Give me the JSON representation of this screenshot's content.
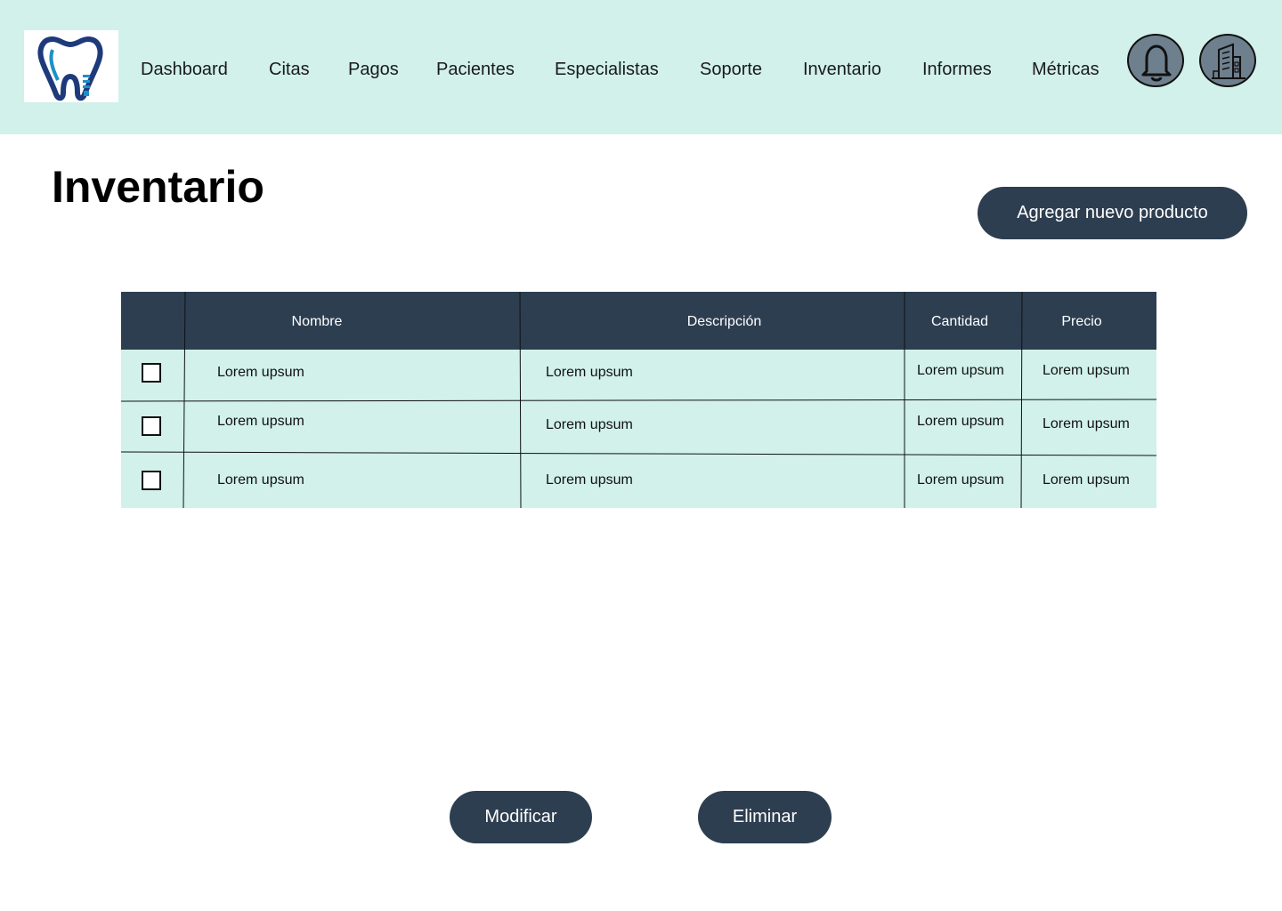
{
  "nav": {
    "items": [
      "Dashboard",
      "Citas",
      "Pagos",
      "Pacientes",
      "Especialistas",
      "Soporte",
      "Inventario",
      "Informes",
      "Métricas"
    ]
  },
  "icons": {
    "logo": "tooth-logo-icon",
    "notifications": "bell-icon",
    "clinic": "building-icon"
  },
  "page": {
    "title": "Inventario",
    "add_button": "Agregar nuevo producto"
  },
  "table": {
    "columns": [
      "Nombre",
      "Descripción",
      "Cantidad",
      "Precio"
    ],
    "rows": [
      {
        "checked": false,
        "nombre": "Lorem upsum",
        "descripcion": "Lorem upsum",
        "cantidad": "Lorem upsum",
        "precio": "Lorem upsum"
      },
      {
        "checked": false,
        "nombre": "Lorem upsum",
        "descripcion": "Lorem upsum",
        "cantidad": "Lorem upsum",
        "precio": "Lorem upsum"
      },
      {
        "checked": false,
        "nombre": "Lorem upsum",
        "descripcion": "Lorem upsum",
        "cantidad": "Lorem upsum",
        "precio": "Lorem upsum"
      }
    ]
  },
  "actions": {
    "modify": "Modificar",
    "delete": "Eliminar"
  },
  "colors": {
    "accent_bg": "#d1f1ea",
    "dark": "#2d3e50",
    "icon_button": "#6e7f8d",
    "logo_blue_dark": "#1e3a7b",
    "logo_blue_light": "#1e90c8"
  }
}
